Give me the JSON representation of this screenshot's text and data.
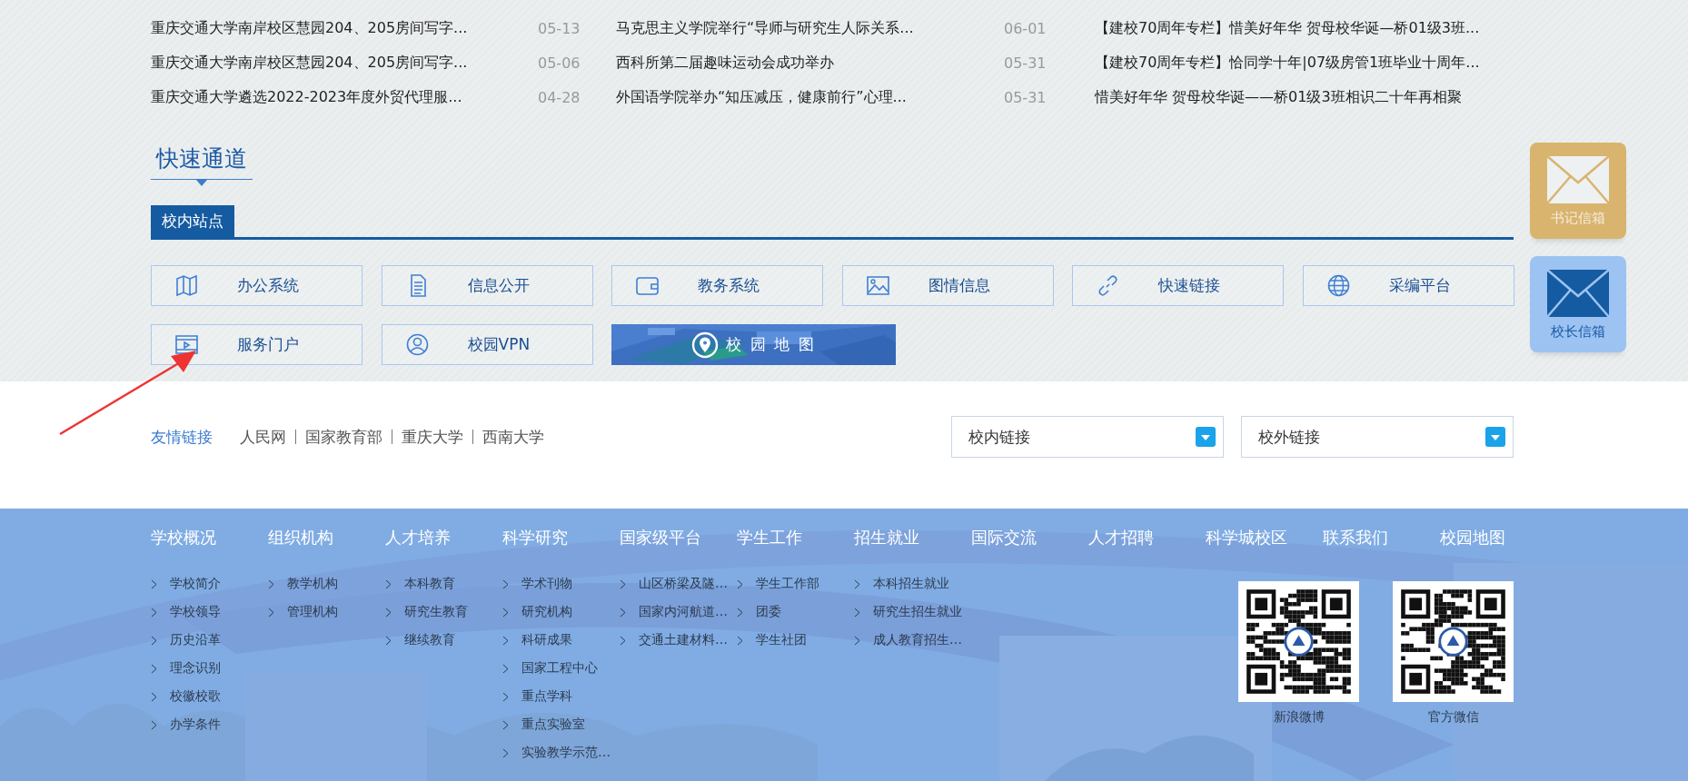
{
  "news_rows": [
    {
      "cells": [
        {
          "kind": "title",
          "text": "重庆交通大学南岸校区慧园204、205房间写字..."
        },
        {
          "kind": "date",
          "text": "05-13"
        },
        {
          "kind": "title",
          "text": "马克思主义学院举行“导师与研究生人际关系..."
        },
        {
          "kind": "date",
          "text": "06-01"
        },
        {
          "kind": "title",
          "text": "【建校70周年专栏】惜美好年华 贺母校华诞—桥01级3班..."
        }
      ]
    },
    {
      "cells": [
        {
          "kind": "title",
          "text": "重庆交通大学南岸校区慧园204、205房间写字..."
        },
        {
          "kind": "date",
          "text": "05-06"
        },
        {
          "kind": "title",
          "text": "西科所第二届趣味运动会成功举办"
        },
        {
          "kind": "date",
          "text": "05-31"
        },
        {
          "kind": "title",
          "text": "【建校70周年专栏】恰同学十年|07级房管1班毕业十周年..."
        }
      ]
    },
    {
      "cells": [
        {
          "kind": "title",
          "text": "重庆交通大学遴选2022-2023年度外贸代理服..."
        },
        {
          "kind": "date",
          "text": "04-28"
        },
        {
          "kind": "title",
          "text": "外国语学院举办“知压减压，健康前行”心理..."
        },
        {
          "kind": "date",
          "text": "05-31"
        },
        {
          "kind": "title",
          "text": "惜美好年华 贺母校华诞——桥01级3班相识二十年再相聚"
        }
      ]
    }
  ],
  "quick_access": {
    "title": "快速通道",
    "tabs": [
      {
        "label": "校内站点",
        "selected": true
      }
    ],
    "links": [
      {
        "kind": "link",
        "label": "办公系统"
      },
      {
        "kind": "link",
        "label": "信息公开"
      },
      {
        "kind": "link",
        "label": "教务系统"
      },
      {
        "kind": "link",
        "label": "图情信息"
      },
      {
        "kind": "link",
        "label": "快速链接"
      },
      {
        "kind": "link",
        "label": "采编平台"
      },
      {
        "kind": "link",
        "label": "服务门户"
      },
      {
        "kind": "link",
        "label": "校园VPN"
      },
      {
        "kind": "map",
        "label": "校 园 地 图"
      }
    ]
  },
  "mailboxes": [
    {
      "label": "书记信箱",
      "color": "#d9b46f"
    },
    {
      "label": "校长信箱",
      "color": "#9cc3f2"
    }
  ],
  "friend_links": {
    "label": "友情链接",
    "links": [
      "人民网",
      "国家教育部",
      "重庆大学",
      "西南大学"
    ],
    "dropdowns": [
      "校内链接",
      "校外链接"
    ]
  },
  "footer": {
    "columns": [
      {
        "heading": "学校概况",
        "items": [
          "学校简介",
          "学校领导",
          "历史沿革",
          "理念识别",
          "校徽校歌",
          "办学条件"
        ]
      },
      {
        "heading": "组织机构",
        "items": [
          "教学机构",
          "管理机构"
        ]
      },
      {
        "heading": "人才培养",
        "items": [
          "本科教育",
          "研究生教育",
          "继续教育"
        ]
      },
      {
        "heading": "科学研究",
        "items": [
          "学术刊物",
          "研究机构",
          "科研成果",
          "国家工程中心",
          "重点学科",
          "重点实验室",
          "实验教学示范…"
        ]
      },
      {
        "heading": "国家级平台",
        "items": [
          "山区桥梁及隧…",
          "国家内河航道…",
          "交通土建材料…"
        ]
      },
      {
        "heading": "学生工作",
        "items": [
          "学生工作部",
          "团委",
          "学生社团"
        ]
      },
      {
        "heading": "招生就业",
        "items": [
          "本科招生就业",
          "研究生招生就业",
          "成人教育招生…"
        ]
      },
      {
        "heading": "国际交流"
      },
      {
        "heading": "人才招聘"
      },
      {
        "heading": "科学城校区"
      },
      {
        "heading": "联系我们"
      },
      {
        "heading": "校园地图"
      }
    ],
    "qr_codes": [
      {
        "caption": "新浪微博"
      },
      {
        "caption": "官方微信"
      }
    ]
  }
}
